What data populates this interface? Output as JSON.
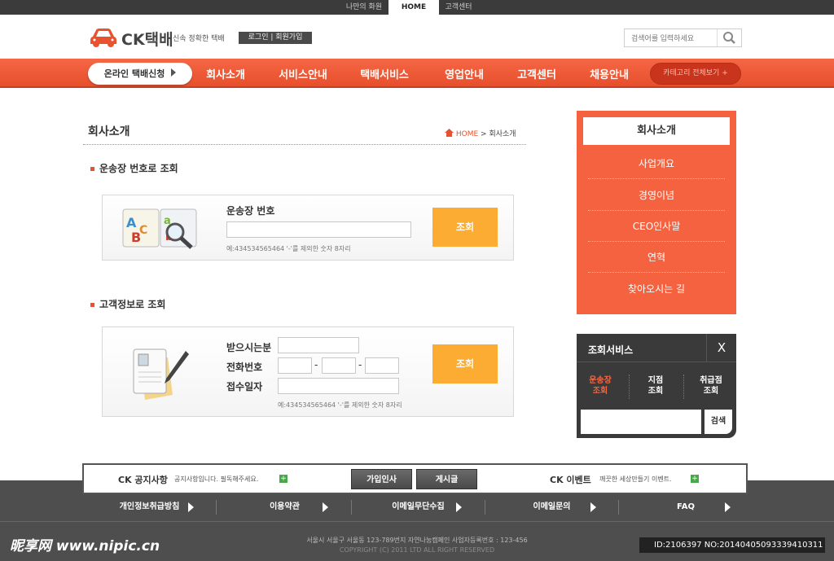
{
  "top_links": {
    "my": "나만의 화원",
    "home": "HOME",
    "cs": "고객센터"
  },
  "header": {
    "logo": "CK택배",
    "tagline": "신속 정확한 택배",
    "login": "로그인  |  회원가입",
    "search_placeholder": "검색어를 입력하세요"
  },
  "nav": {
    "apply": "온라인 택배신청",
    "items": [
      "회사소개",
      "서비스안내",
      "택배서비스",
      "영업안내",
      "고객센터",
      "채용안내"
    ],
    "all": "카테고리 전체보기 +"
  },
  "page": {
    "title": "회사소개",
    "breadcrumb_home": "HOME",
    "breadcrumb_current": "회사소개"
  },
  "section1": {
    "title": "운송장 번호로 조회",
    "label": "운송장 번호",
    "hint": "예:434534565464 '-'를 제외한 숫자 8자리",
    "button": "조회"
  },
  "section2": {
    "title": "고객정보로 조회",
    "label_name": "받으시는분",
    "label_phone": "전화번호",
    "label_date": "접수일자",
    "hint": "예:434534565464 '-'를 제외한 숫자 8자리",
    "button": "조회",
    "dash": "-"
  },
  "right_menu": {
    "title": "회사소개",
    "items": [
      "사업개요",
      "경영이념",
      "CEO인사말",
      "연혁",
      "찾아오시는 길"
    ]
  },
  "service": {
    "title": "조회서비스",
    "close": "X",
    "tabs": [
      {
        "l1": "운송장",
        "l2": "조회"
      },
      {
        "l1": "지점",
        "l2": "조회"
      },
      {
        "l1": "취급점",
        "l2": "조회"
      }
    ],
    "button": "검색"
  },
  "notice": {
    "t1": "CK 공지사항",
    "x1": "공지사항입니다. 필독해주세요.",
    "btn1": "가입인사",
    "btn2": "게시글",
    "t2": "CK 이벤트",
    "x2": "깨끗한 세상만들기 이벤트.",
    "plus": "+"
  },
  "footer": {
    "links": [
      "개인정보취급방침",
      "이용약관",
      "이메일무단수집",
      "이메일문의",
      "FAQ"
    ],
    "address": "서울시 서울구 서울동 123-789번지 자연나눔캠페인 사업자등록번호 : 123-456",
    "copyright": "COPYRIGHT (C) 2011 LTD ALL RIGHT RESERVED"
  },
  "watermark": {
    "site": "昵享网 www.nipic.cn",
    "id": "ID:2106397 NO:20140405093339410311"
  },
  "colors": {
    "accent": "#e8522f",
    "button": "#fcac33",
    "dark": "#3a3a3a"
  }
}
